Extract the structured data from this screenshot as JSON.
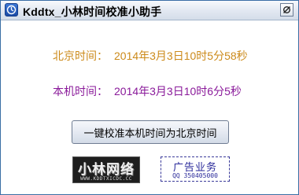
{
  "window": {
    "title": "Kddtx_小林时间校准小助手",
    "icon": "clock-app-icon",
    "close_icon": "close-icon"
  },
  "beijing_time": {
    "label": "北京时间：",
    "value": "2014年3月3日10时5分58秒",
    "color": "#cc8a1a"
  },
  "local_time": {
    "label": "本机时间：",
    "value": "2014年3月3日10时6分5秒",
    "color": "#8a1a9a"
  },
  "sync_button": {
    "label": "一键校准本机时间为北京时间"
  },
  "logo_left": {
    "text": "小林网络",
    "subtext": "WWW.KDDTXICDC.CC"
  },
  "logo_right": {
    "text": "广告业务",
    "subtext": "QQ 350405000"
  }
}
